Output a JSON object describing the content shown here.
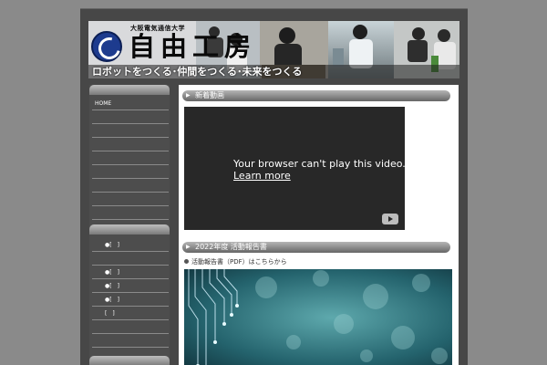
{
  "header": {
    "university": "大阪電気通信大学",
    "brand": "自由工房",
    "slogan": "ロボットをつくる･仲間をつくる･未来をつくる"
  },
  "sidebar": {
    "menu1": [
      "HOME",
      "",
      "",
      "",
      "",
      "",
      "",
      "",
      ""
    ],
    "menu2": [
      "●[　]",
      "",
      "●[　]",
      "●[　]",
      "●[　]",
      "[　]",
      "",
      ""
    ]
  },
  "main": {
    "section1_title": "新着動画",
    "video": {
      "message": "Your browser can't play this video.",
      "link": "Learn more"
    },
    "section2_title": "2022年度 活動報告書",
    "note": "活動報告書（PDF）はこちらから"
  },
  "colors": {
    "page_bg": "#8a8a8a",
    "frame": "#474747",
    "accent_blue": "#1d3b8e",
    "circuit": "#2a7d86"
  },
  "icons": [
    "logo-mark-icon",
    "play-icon",
    "bullet-icon"
  ]
}
